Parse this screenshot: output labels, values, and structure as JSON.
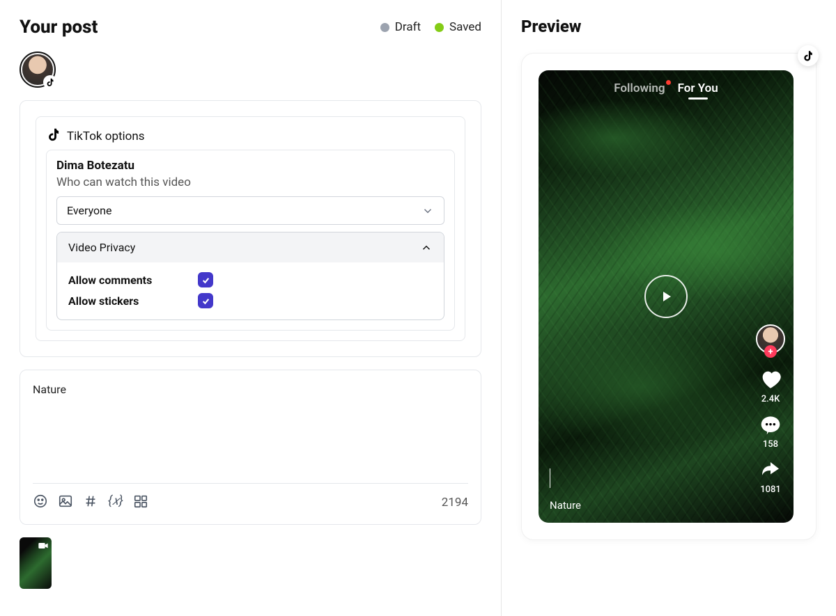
{
  "header": {
    "title": "Your post",
    "status": {
      "draft_label": "Draft",
      "saved_label": "Saved"
    }
  },
  "account": {
    "name": "Dima Botezatu"
  },
  "options": {
    "section_label": "TikTok options",
    "who_label": "Who can watch this video",
    "who_value": "Everyone",
    "privacy": {
      "header": "Video Privacy",
      "allow_comments_label": "Allow comments",
      "allow_comments_checked": true,
      "allow_stickers_label": "Allow stickers",
      "allow_stickers_checked": true
    }
  },
  "caption": {
    "text": "Nature",
    "char_count": "2194"
  },
  "preview": {
    "title": "Preview",
    "tabs": {
      "following": "Following",
      "for_you": "For You"
    },
    "stats": {
      "likes": "2.4K",
      "comments": "158",
      "shares": "1081"
    },
    "caption": "Nature"
  },
  "colors": {
    "checkbox_bg": "#4338ca",
    "saved_dot": "#84cc16",
    "draft_dot": "#9ca3af"
  }
}
